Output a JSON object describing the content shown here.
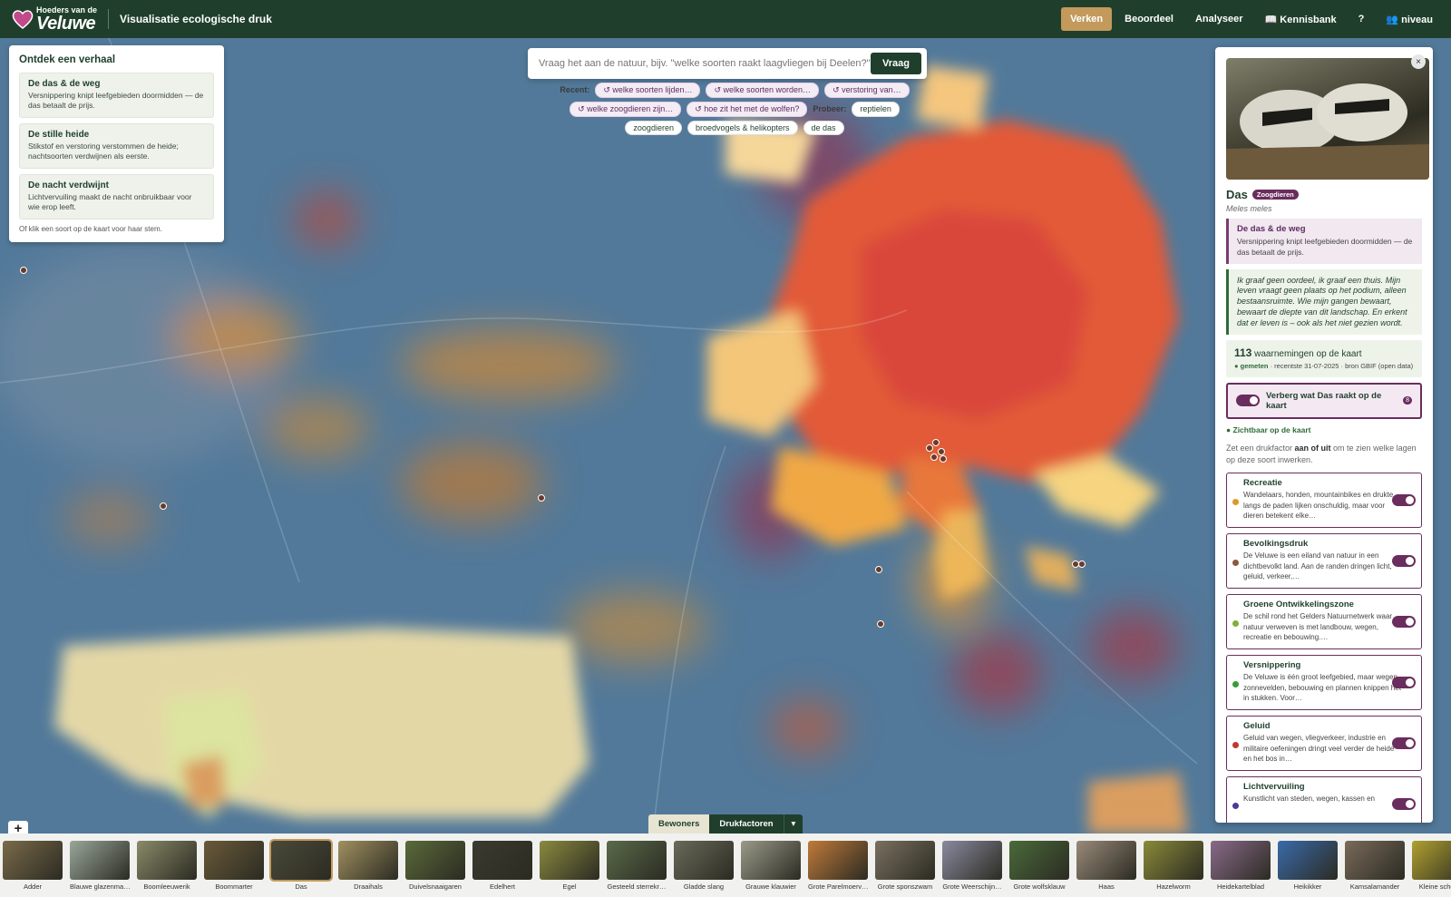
{
  "header": {
    "logo_small": "Hoeders van de",
    "logo_big": "Veluwe",
    "app_title": "Visualisatie ecologische druk",
    "nav": [
      {
        "label": "Verken",
        "active": true
      },
      {
        "label": "Beoordeel"
      },
      {
        "label": "Analyseer"
      },
      {
        "label": "📖 Kennisbank"
      },
      {
        "label": "?"
      },
      {
        "label": "👥 niveau"
      }
    ]
  },
  "stories": {
    "title": "Ontdek een verhaal",
    "items": [
      {
        "title": "De das & de weg",
        "desc": "Versnippering knipt leefgebieden doormidden — de das betaalt de prijs."
      },
      {
        "title": "De stille heide",
        "desc": "Stikstof en verstoring verstommen de heide; nachtsoorten verdwijnen als eerste."
      },
      {
        "title": "De nacht verdwijnt",
        "desc": "Lichtvervuiling maakt de nacht onbruikbaar voor wie erop leeft."
      }
    ],
    "hint": "Of klik een soort op de kaart voor haar stem."
  },
  "search": {
    "placeholder": "Vraag het aan de natuur, bijv. \"welke soorten raakt laagvliegen bij Deelen?\"",
    "button": "Vraag",
    "recent_label": "Recent:",
    "recent": [
      "↺ welke soorten lijden…",
      "↺ welke soorten worden…",
      "↺ verstoring van…",
      "↺ welke zoogdieren zijn…",
      "↺ hoe zit het met de wolfen?"
    ],
    "try_label": "Probeer:",
    "try": [
      "reptielen",
      "zoogdieren",
      "broedvogels & helikopters",
      "de das"
    ]
  },
  "species_panel": {
    "close": "×",
    "name": "Das",
    "badge": "Zoogdieren",
    "latin": "Meles meles",
    "story_title": "De das & de weg",
    "story_desc": "Versnippering knipt leefgebieden doormidden — de das betaalt de prijs.",
    "quote": "Ik graaf geen oordeel, ik graaf een thuis. Mijn leven vraagt geen plaats op het podium, alleen bestaansruimte. Wie mijn gangen bewaart, bewaart de diepte van dit landschap. En erkent dat er leven is – ook als het niet gezien wordt.",
    "obs_count": "113",
    "obs_label": "waarnemingen op de kaart",
    "obs_measured": "● gemeten",
    "obs_meta": "· recentste 31-07-2025 · bron GBIF (open data)",
    "toggle_label": "Verberg wat Das raakt op de kaart",
    "toggle_count": "8",
    "visible_label": "● Zichtbaar op de kaart",
    "hint_pre": "Zet een drukfactor ",
    "hint_bold": "aan of uit",
    "hint_post": " om te zien welke lagen op deze soort inwerken.",
    "factors": [
      {
        "title": "Recreatie",
        "desc": "Wandelaars, honden, mountainbikes en drukte langs de paden lijken onschuldig, maar voor dieren betekent elke…",
        "color": "#d99a2b"
      },
      {
        "title": "Bevolkingsdruk",
        "desc": "De Veluwe is een eiland van natuur in een dichtbevolkt land. Aan de randen dringen licht, geluid, verkeer,…",
        "color": "#8a5a3b"
      },
      {
        "title": "Groene Ontwikkelingszone",
        "desc": "De schil rond het Gelders Natuurnetwerk waar natuur verweven is met landbouw, wegen, recreatie en bebouwing.…",
        "color": "#7fb03a"
      },
      {
        "title": "Versnippering",
        "desc": "De Veluwe is één groot leefgebied, maar wegen, zonnevelden, bebouwing en plannen knippen het in stukken. Voor…",
        "color": "#3a9a3a"
      },
      {
        "title": "Geluid",
        "desc": "Geluid van wegen, vliegverkeer, industrie en militaire oefeningen dringt veel verder de heide en het bos in…",
        "color": "#c0392b"
      },
      {
        "title": "Lichtvervuiling",
        "desc": "Kunstlicht van steden, wegen, kassen en",
        "color": "#4a3a9a"
      }
    ]
  },
  "layer_tabs": {
    "tab1": "Bewoners",
    "tab2": "Drukfactoren",
    "dropdown": "▾"
  },
  "zoom_in": "+",
  "species_strip": [
    {
      "name": "Adder",
      "color": "#7a6a4a"
    },
    {
      "name": "Blauwe glazenma…",
      "color": "#9aa79a"
    },
    {
      "name": "Boomleeuwerik",
      "color": "#8a8a6a"
    },
    {
      "name": "Boommarter",
      "color": "#6a5a3a"
    },
    {
      "name": "Das",
      "color": "#4a4a3a",
      "selected": true
    },
    {
      "name": "Draaihals",
      "color": "#a09060"
    },
    {
      "name": "Duivelsnaaigaren",
      "color": "#5a6a3a"
    },
    {
      "name": "Edelhert",
      "color": "#3a3a30"
    },
    {
      "name": "Egel",
      "color": "#8a8a40"
    },
    {
      "name": "Gesteeld sterrekr…",
      "color": "#5a6a4a"
    },
    {
      "name": "Gladde slang",
      "color": "#6a6a5a"
    },
    {
      "name": "Grauwe klauwier",
      "color": "#9a9a8a"
    },
    {
      "name": "Grote Parelmoerv…",
      "color": "#c07a3a"
    },
    {
      "name": "Grote sponszwam",
      "color": "#7a7060"
    },
    {
      "name": "Grote Weerschijn…",
      "color": "#8a8aa0"
    },
    {
      "name": "Grote wolfsklauw",
      "color": "#4a6a3a"
    },
    {
      "name": "Haas",
      "color": "#9a8a7a"
    },
    {
      "name": "Hazelworm",
      "color": "#8a8a3a"
    },
    {
      "name": "Heidekartelblad",
      "color": "#8a6a8a"
    },
    {
      "name": "Heikikker",
      "color": "#3a6aaa"
    },
    {
      "name": "Kamsalamander",
      "color": "#7a6a5a"
    },
    {
      "name": "Kleine schoo…",
      "color": "#b0a030"
    }
  ]
}
